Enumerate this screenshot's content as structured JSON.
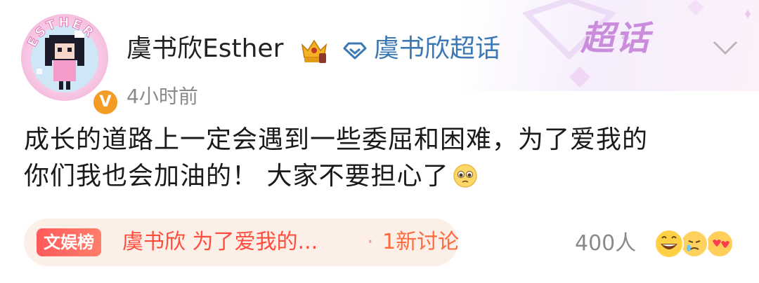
{
  "post": {
    "author": "虞书欣Esther",
    "avatar_arc_text": "ESTHER",
    "verified_badge": "V",
    "super_topic_label": "虞书欣超话",
    "super_topic_deco": "超话",
    "time": "4小时前",
    "text_line1": "成长的道路上一定会遇到一些委屈和困难，为了爱我的",
    "text_line2": "你们我也会加油的！ 大家不要担心了",
    "inline_emoji": "pleading-face"
  },
  "topic": {
    "badge": "文娱榜",
    "title": "虞书欣 为了爱我的...",
    "separator": "·",
    "discussion": "1新讨论"
  },
  "reactions": {
    "count": "400人",
    "icons": [
      "grinning-face-icon",
      "crying-face-icon",
      "heart-face-icon"
    ]
  },
  "colors": {
    "link": "#3c78b4",
    "topic_text": "#ff4d3d",
    "topic_bg": "#fcefe8",
    "badge_gradient": "#ff5a5a",
    "verified": "#f29b25",
    "muted": "#8a8a8a"
  }
}
